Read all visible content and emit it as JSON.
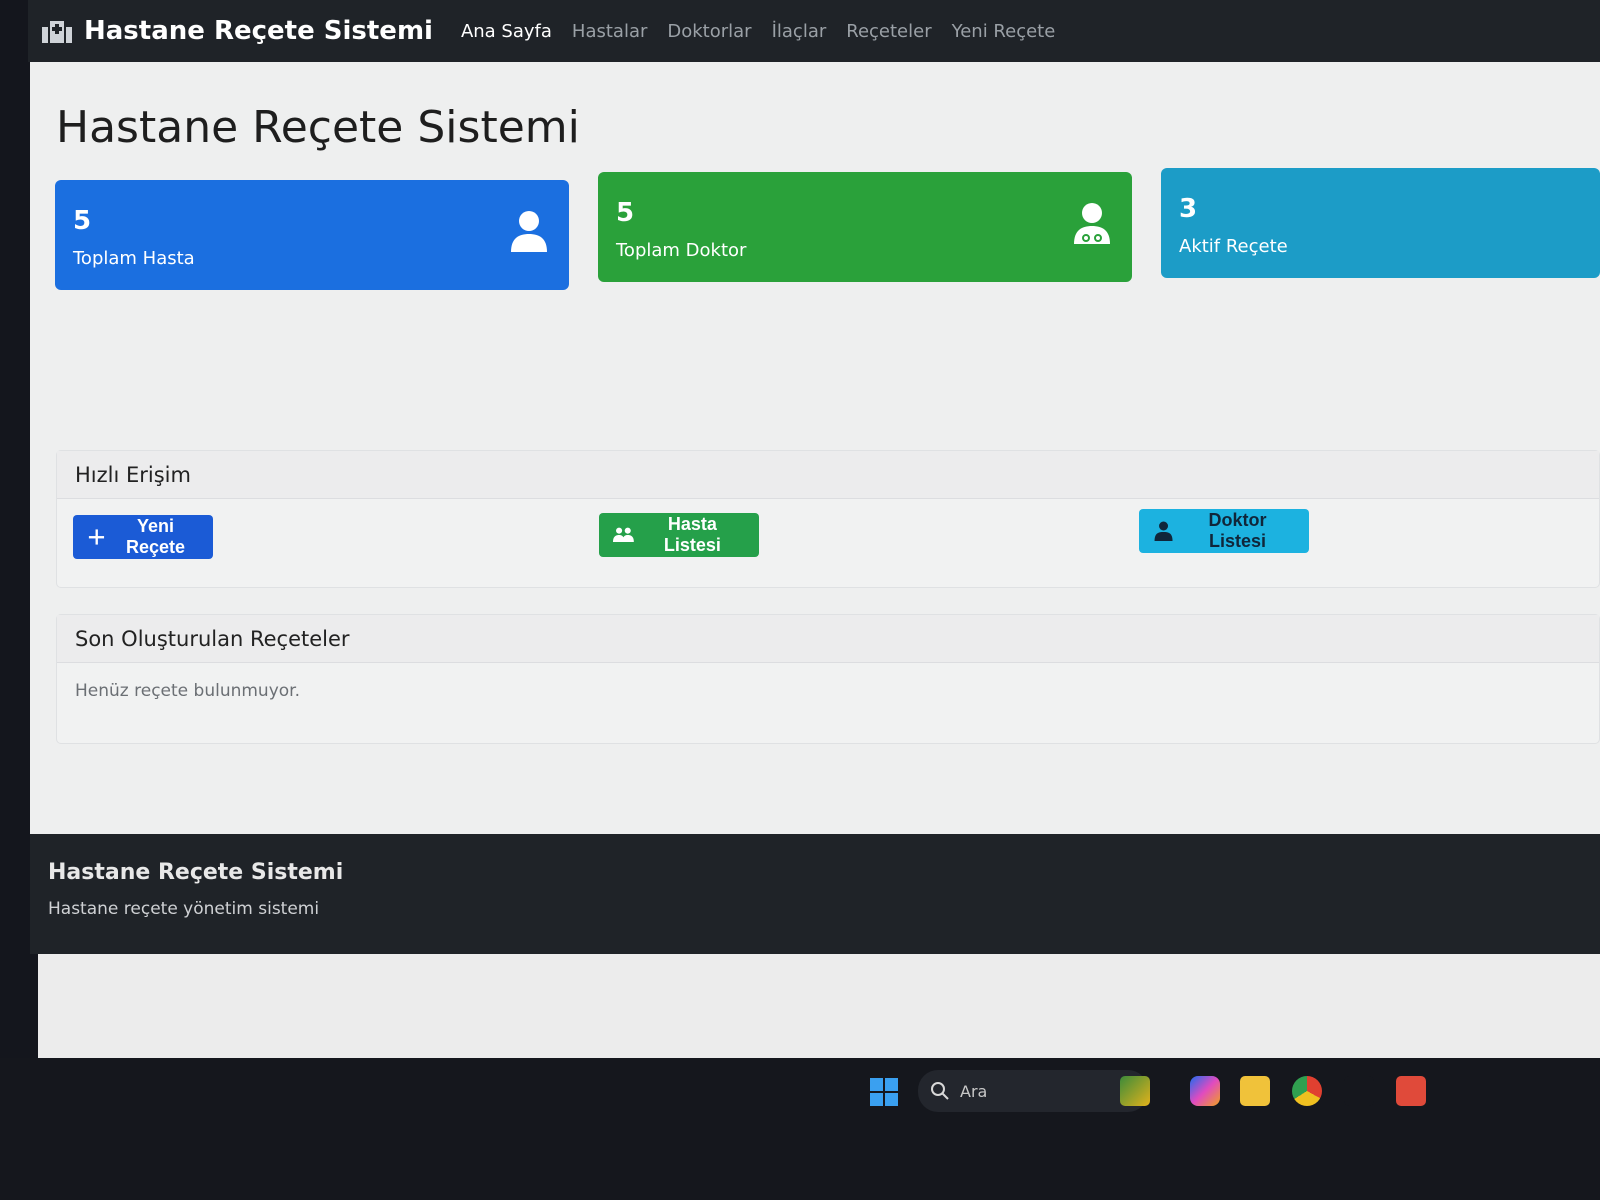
{
  "navbar": {
    "brand": "Hastane Reçete Sistemi",
    "links": [
      "Ana Sayfa",
      "Hastalar",
      "Doktorlar",
      "İlaçlar",
      "Reçeteler",
      "Yeni Reçete"
    ]
  },
  "page_title": "Hastane Reçete Sistemi",
  "stats": [
    {
      "value": "5",
      "label": "Toplam Hasta",
      "icon": "user-icon",
      "color": "#1b6fe0"
    },
    {
      "value": "5",
      "label": "Toplam Doktor",
      "icon": "doctor-icon",
      "color": "#2aa13a"
    },
    {
      "value": "3",
      "label": "Aktif Reçete",
      "color": "#1c9cc7"
    }
  ],
  "quick_access": {
    "title": "Hızlı Erişim",
    "buttons": [
      {
        "label": "Yeni Reçete",
        "icon": "plus-icon"
      },
      {
        "label": "Hasta Listesi",
        "icon": "users-icon"
      },
      {
        "label": "Doktor Listesi",
        "icon": "doctor-icon"
      }
    ]
  },
  "recent": {
    "title": "Son Oluşturulan Reçeteler",
    "empty_message": "Henüz reçete bulunmuyor."
  },
  "footer": {
    "title": "Hastane Reçete Sistemi",
    "subtitle": "Hastane reçete yönetim sistemi"
  },
  "taskbar": {
    "search_placeholder": "Ara"
  }
}
